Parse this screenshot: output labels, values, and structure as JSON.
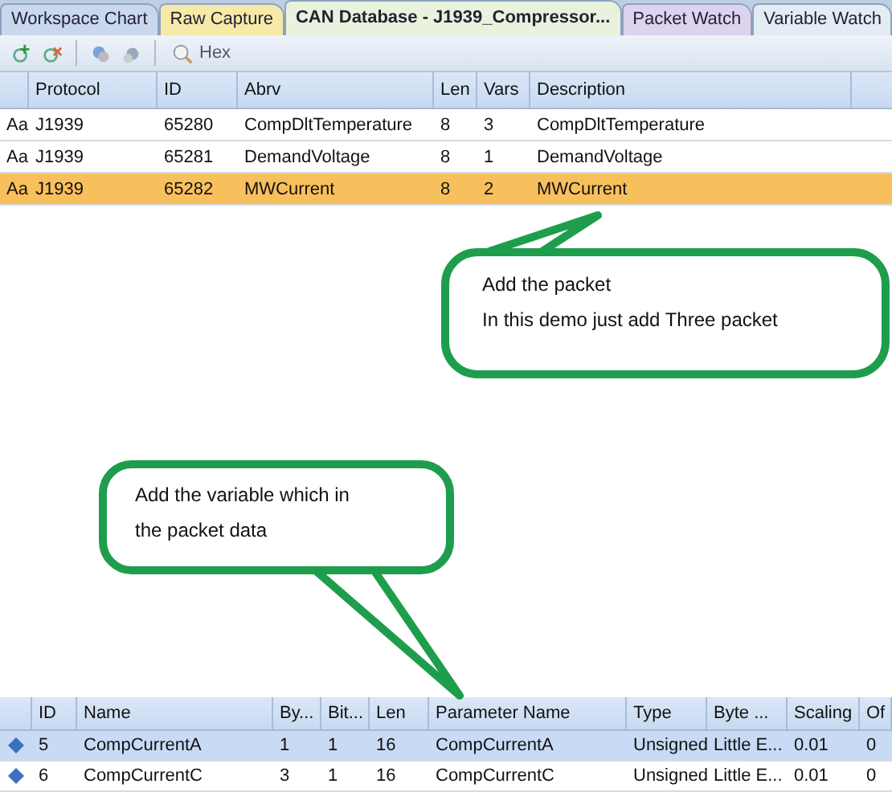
{
  "tabs": [
    {
      "label": "Workspace Chart",
      "selected": false,
      "color": "#c9d8ef"
    },
    {
      "label": "Raw Capture",
      "selected": false,
      "color": "#f7e9a8"
    },
    {
      "label": "CAN Database - J1939_Compressor...",
      "selected": true,
      "color": "#e9f2dc"
    },
    {
      "label": "Packet Watch",
      "selected": false,
      "color": "#ddd3ee"
    },
    {
      "label": "Variable Watch",
      "selected": false,
      "color": "#e3ebf3"
    }
  ],
  "toolbar": {
    "hex_button": "Hex"
  },
  "packets": {
    "columns": [
      "Protocol",
      "ID",
      "Abrv",
      "Len",
      "Vars",
      "Description"
    ],
    "rows": [
      {
        "marker": "Aa",
        "cells": [
          "J1939",
          "65280",
          "CompDltTemperature",
          "8",
          "3",
          "CompDltTemperature"
        ],
        "selected": false
      },
      {
        "marker": "Aa",
        "cells": [
          "J1939",
          "65281",
          "DemandVoltage",
          "8",
          "1",
          "DemandVoltage"
        ],
        "selected": false
      },
      {
        "marker": "Aa",
        "cells": [
          "J1939",
          "65282",
          "MWCurrent",
          "8",
          "2",
          "MWCurrent"
        ],
        "selected": true
      }
    ]
  },
  "callouts": [
    {
      "lines": [
        "Add the packet",
        "In this demo just add Three  packet"
      ]
    },
    {
      "lines": [
        "Add the variable which in",
        "the packet data"
      ]
    }
  ],
  "variables": {
    "columns": [
      "ID",
      "Name",
      "By...",
      "Bit...",
      "Len",
      "Parameter Name",
      "Type",
      "Byte ...",
      "Scaling",
      "Of"
    ],
    "rows": [
      {
        "cells": [
          "5",
          "CompCurrentA",
          "1",
          "1",
          "16",
          "CompCurrentA",
          "Unsigned",
          "Little E...",
          "0.01",
          "0"
        ],
        "selected": true
      },
      {
        "cells": [
          "6",
          "CompCurrentC",
          "3",
          "1",
          "16",
          "CompCurrentC",
          "Unsigned",
          "Little E...",
          "0.01",
          "0"
        ],
        "selected": false
      }
    ]
  }
}
